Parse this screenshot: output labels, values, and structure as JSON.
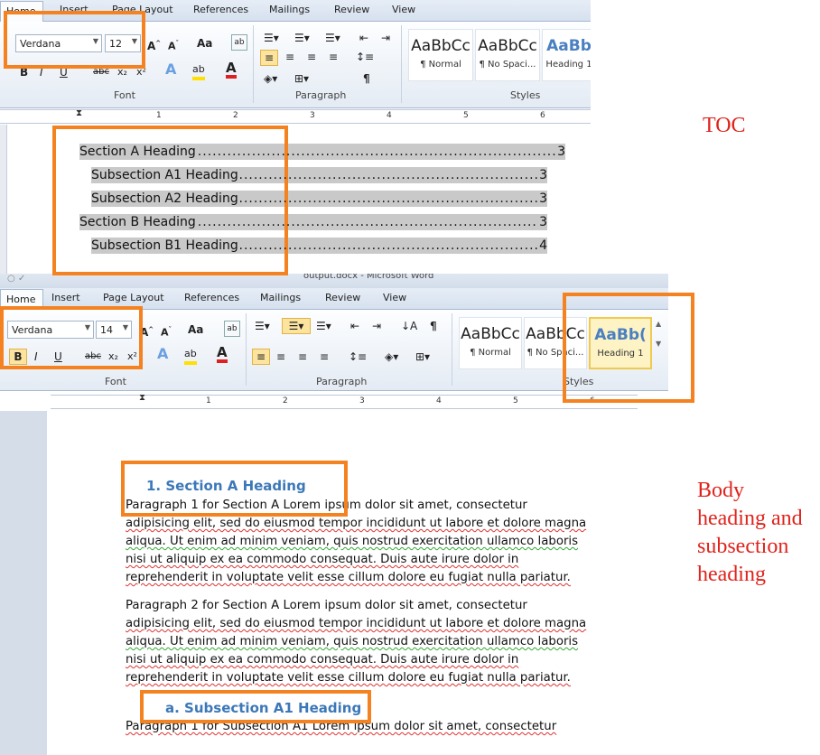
{
  "tabs": [
    "Home",
    "Insert",
    "Page Layout",
    "References",
    "Mailings",
    "Review",
    "View"
  ],
  "top_ribbon": {
    "font_name": "Verdana",
    "font_size": "12",
    "group_font": "Font",
    "group_paragraph": "Paragraph",
    "group_styles": "Styles",
    "styles": [
      {
        "preview": "AaBbCc",
        "name": "¶ Normal"
      },
      {
        "preview": "AaBbCc",
        "name": "¶ No Spaci..."
      },
      {
        "preview": "AaBb",
        "name": "Heading 1"
      }
    ]
  },
  "toc": {
    "entries": [
      {
        "text": "Section A Heading",
        "page": "3",
        "level": 1
      },
      {
        "text": "Subsection A1 Heading",
        "page": "3",
        "level": 2
      },
      {
        "text": "Subsection A2 Heading",
        "page": "3",
        "level": 2
      },
      {
        "text": "Section B Heading",
        "page": "3",
        "level": 1
      },
      {
        "text": "Subsection B1 Heading",
        "page": "4",
        "level": 2
      }
    ]
  },
  "title_bar_text": "output.docx - Microsoft Word",
  "bottom_ribbon": {
    "font_name": "Verdana",
    "font_size": "14",
    "group_font": "Font",
    "group_paragraph": "Paragraph",
    "group_styles": "Styles",
    "styles": [
      {
        "preview": "AaBbCc",
        "name": "¶ Normal"
      },
      {
        "preview": "AaBbCc",
        "name": "¶ No Spaci..."
      },
      {
        "preview": "AaBb(",
        "name": "Heading 1"
      }
    ]
  },
  "ruler_numbers": [
    "1",
    "2",
    "3",
    "4",
    "5",
    "6"
  ],
  "document": {
    "heading1": "1. Section A Heading",
    "para1": [
      "Paragraph  1 for Section A Lorem ipsum dolor sit amet, consectetur",
      "adipisicing elit, sed do eiusmod tempor incididunt ut labore et dolore magna",
      "aliqua. Ut enim ad minim veniam, quis nostrud exercitation ullamco laboris",
      "nisi ut aliquip ex ea commodo consequat. Duis aute irure dolor in",
      "reprehenderit in voluptate velit esse cillum dolore eu fugiat nulla pariatur."
    ],
    "para2": [
      "Paragraph  2 for Section A Lorem ipsum dolor sit amet, consectetur",
      "adipisicing elit, sed do eiusmod tempor incididunt ut labore et dolore magna",
      "aliqua. Ut enim ad minim veniam, quis nostrud exercitation ullamco laboris",
      "nisi ut aliquip ex ea commodo consequat. Duis aute irure dolor in",
      "reprehenderit in voluptate velit esse cillum dolore eu fugiat nulla pariatur."
    ],
    "heading2": "a. Subsection A1 Heading",
    "para3_partial": "Paragraph  1 for Subsection A1 Lorem ipsum dolor sit amet, consectetur"
  },
  "annotations": {
    "toc_label": "TOC",
    "body_label": [
      "Body",
      "heading and",
      "subsection",
      "heading"
    ]
  },
  "colors": {
    "annotation_box": "#f58220",
    "annotation_text": "#e0221b",
    "heading_blue": "#3c78b8",
    "toc_highlight": "#c9c9c9"
  }
}
